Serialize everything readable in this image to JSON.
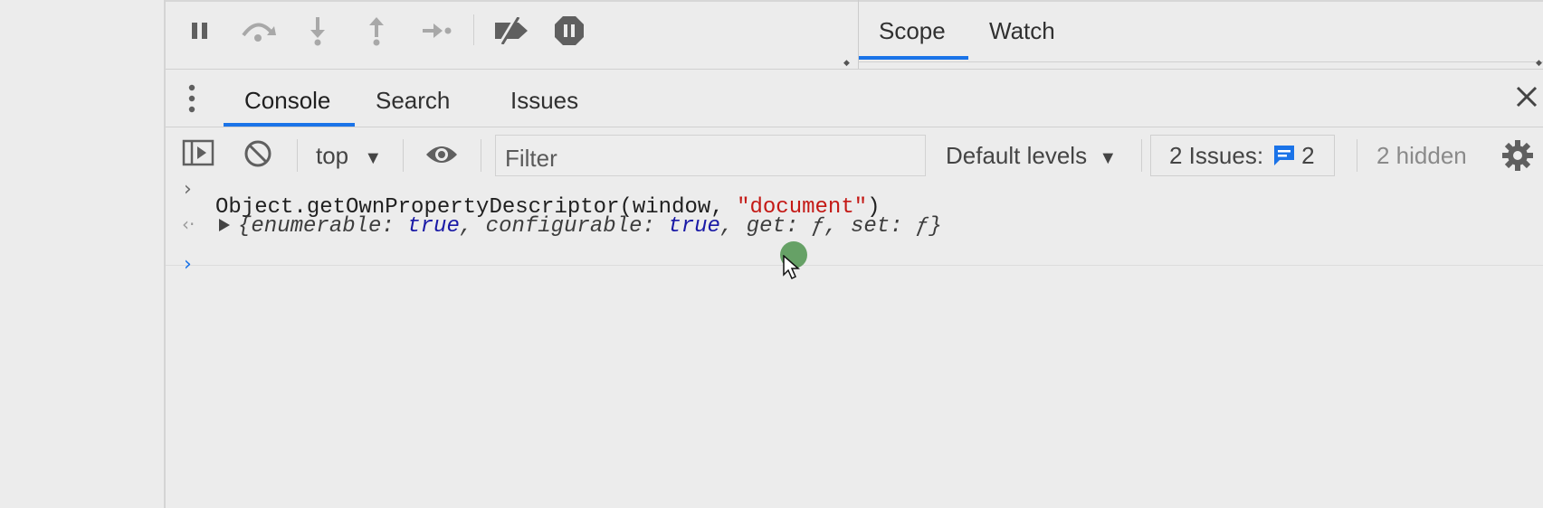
{
  "debugger": {
    "right_tabs": [
      "Scope",
      "Watch"
    ]
  },
  "drawer": {
    "tabs": [
      "Console",
      "Search",
      "Issues"
    ]
  },
  "console_toolbar": {
    "context": "top",
    "filter_placeholder": "Filter",
    "levels_label": "Default levels",
    "issues_label": "2 Issues:",
    "issues_count": "2",
    "hidden_label": "2 hidden"
  },
  "console": {
    "input_line": {
      "prefix": "Object.getOwnPropertyDescriptor(window, ",
      "string_arg": "\"document\"",
      "suffix": ")"
    },
    "result": {
      "open": "{",
      "k1": "enumerable:",
      "v1": "true",
      "sep1": ",",
      "k2": "configurable:",
      "v2": "true",
      "sep2": ",",
      "k3": "get:",
      "v3": "ƒ",
      "sep3": ",",
      "k4": "set:",
      "v4": "ƒ",
      "close": "}"
    }
  },
  "colors": {
    "accent": "#1a73e8",
    "string": "#c41a16",
    "keyword": "#1a1aa6",
    "prompt_blue": "#1a73e8"
  }
}
